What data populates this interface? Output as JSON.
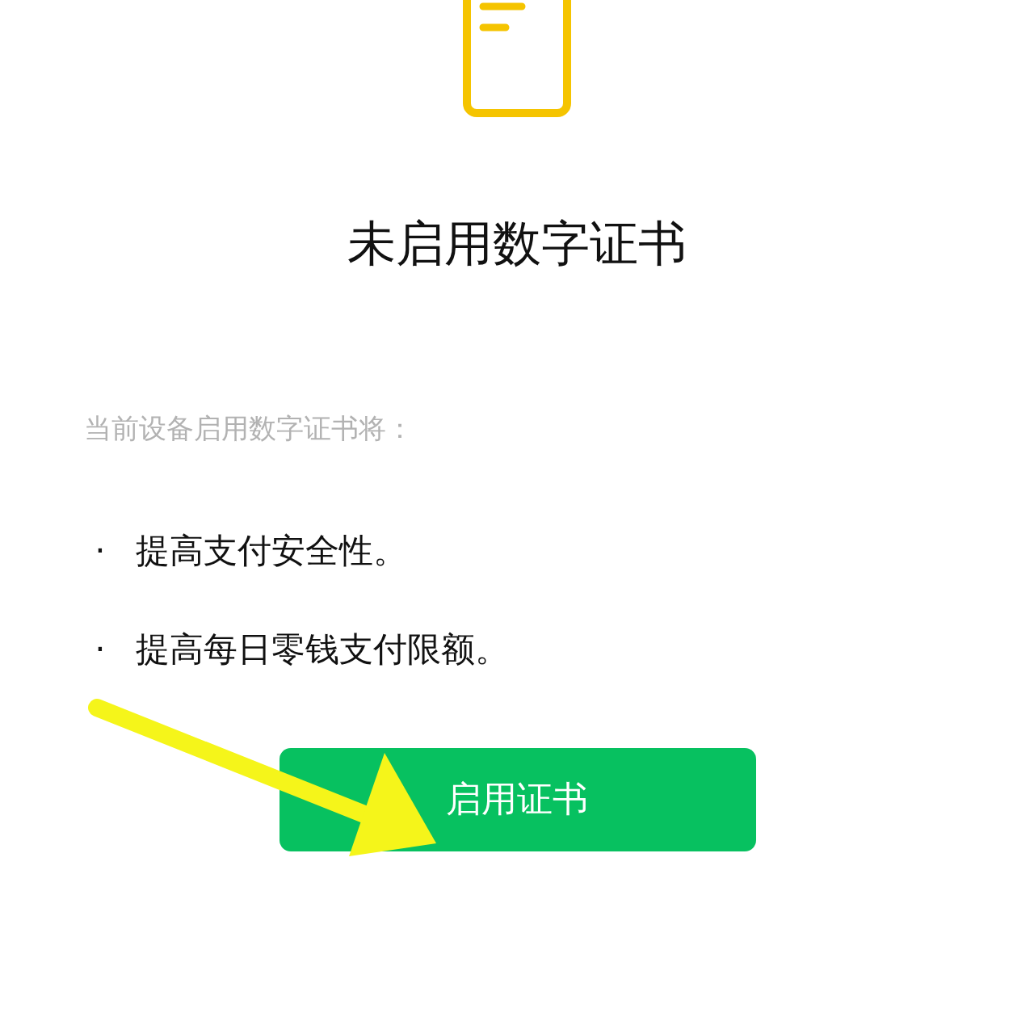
{
  "title": "未启用数字证书",
  "subtitle": "当前设备启用数字证书将：",
  "benefits": [
    {
      "bullet": "·",
      "text": "提高支付安全性。"
    },
    {
      "bullet": "·",
      "text": "提高每日零钱支付限额。"
    }
  ],
  "button": {
    "label": "启用证书"
  }
}
